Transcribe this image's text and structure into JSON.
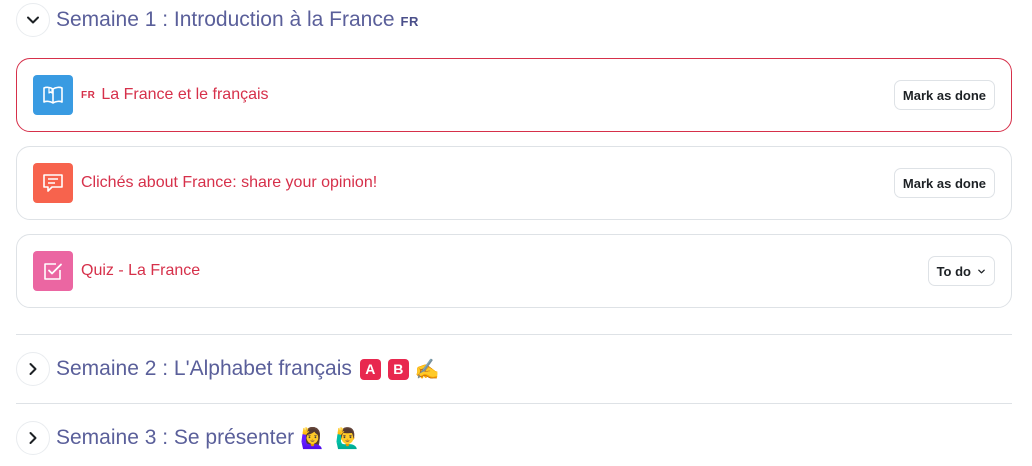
{
  "sections": [
    {
      "title": "Semaine 1 : Introduction à la France",
      "badge": "FR",
      "expanded": true,
      "toggle_icon": "chevron-down-icon"
    },
    {
      "title": "Semaine 2 : L'Alphabet français",
      "badge_a": "A",
      "badge_b": "B",
      "emoji": "✍️",
      "expanded": false,
      "toggle_icon": "chevron-right-icon"
    },
    {
      "title": "Semaine 3 : Se présenter",
      "emoji_1": "🙋‍♀️",
      "emoji_2": "🙋‍♂️",
      "expanded": false,
      "toggle_icon": "chevron-right-icon"
    }
  ],
  "activities": [
    {
      "prefix": "FR",
      "name": "La France et le français",
      "icon": "book-icon",
      "icon_color": "#399be2",
      "button": "Mark as done",
      "highlighted": true
    },
    {
      "name": "Clichés about France: share your opinion!",
      "icon": "forum-icon",
      "icon_color": "#f7634d",
      "button": "Mark as done",
      "highlighted": false
    },
    {
      "name": "Quiz - La France",
      "icon": "quiz-icon",
      "icon_color": "#eb66a2",
      "button": "To do",
      "button_icon": "chevron-down-icon",
      "highlighted": false
    }
  ],
  "colors": {
    "section_title": "#5a5f9a",
    "activity_link": "#d6304a",
    "highlight_border": "#d6304a"
  }
}
